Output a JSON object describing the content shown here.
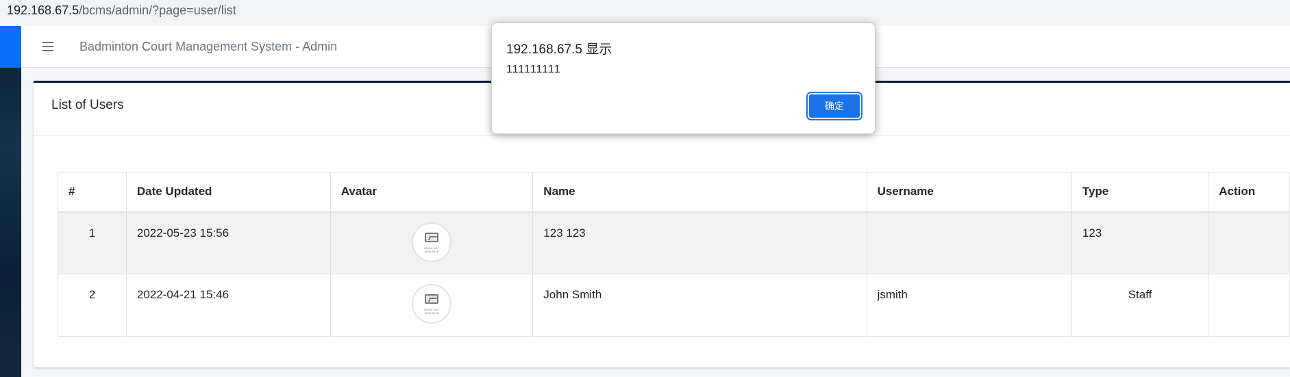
{
  "browser": {
    "url_host": "192.168.67.5",
    "url_path": "/bcms/admin/?page=user/list"
  },
  "navbar": {
    "title": "Badminton Court Management System - Admin"
  },
  "card": {
    "title": "List of Users"
  },
  "table": {
    "headers": [
      "#",
      "Date Updated",
      "Avatar",
      "Name",
      "Username",
      "Type",
      "Action"
    ],
    "rows": [
      {
        "num": "1",
        "date": "2022-05-23 15:56",
        "name": "123 123",
        "username": "",
        "type": "123"
      },
      {
        "num": "2",
        "date": "2022-04-21 15:46",
        "name": "John Smith",
        "username": "jsmith",
        "type": "Staff"
      }
    ],
    "avatar_caption": "IMAGE NOT AVAILABLE"
  },
  "alert": {
    "title": "192.168.67.5 显示",
    "message": "111111111",
    "ok_label": "确定"
  },
  "colors": {
    "accent": "#1a73e8",
    "card_border": "#001f3f",
    "sidebar_top": "#0d6efd"
  },
  "icons": {
    "menu": "hamburger-icon",
    "avatar": "image-placeholder-icon"
  }
}
